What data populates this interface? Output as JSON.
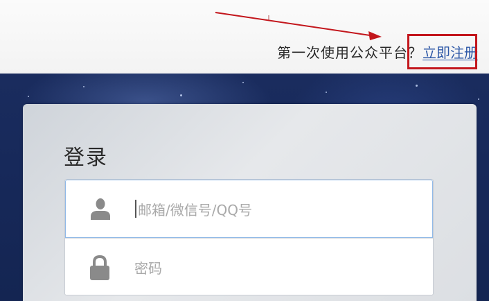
{
  "header": {
    "prompt": "第一次使用公众平台？",
    "register_link": "立即注册"
  },
  "login": {
    "title": "登录",
    "account_placeholder": "邮箱/微信号/QQ号",
    "password_placeholder": "密码"
  },
  "icons": {
    "account": "user-icon",
    "password": "lock-icon"
  },
  "colors": {
    "link": "#2c57a6",
    "highlight": "#c3161c",
    "annotation_arrow": "#c3161c",
    "hero_background": "#17295a"
  }
}
